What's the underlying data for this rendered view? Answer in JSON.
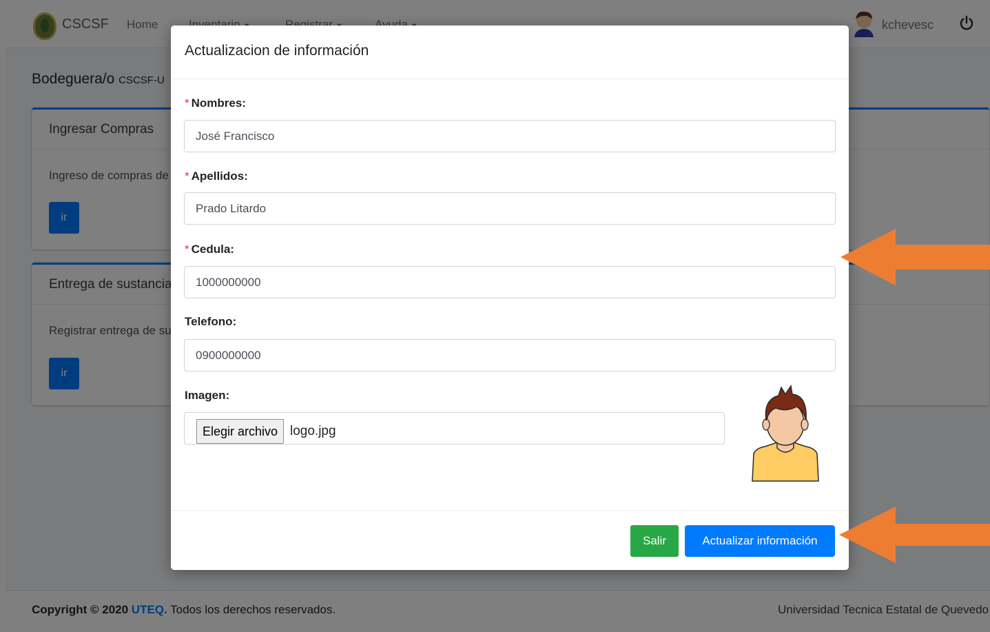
{
  "navbar": {
    "brand": "CSCSF",
    "links": [
      "Home",
      "Inventario",
      "Registrar",
      "Ayuda"
    ],
    "user": "kchevesc",
    "icons": {
      "logo": "university-logo",
      "avatar": "user-avatar-icon",
      "power": "power-icon",
      "dropdown": "caret-down-icon"
    }
  },
  "page": {
    "role_title": "Bodeguera/o",
    "role_code": "CSCSF-U",
    "cards": [
      {
        "title": "Ingresar Compras",
        "text": "Ingreso de compras de",
        "button": "ir"
      },
      {
        "title": "Entrega de sustancias",
        "text": "Registrar entrega de sustancias",
        "button": "ir"
      }
    ]
  },
  "footer": {
    "copyright_prefix": "Copyright © 2020",
    "brand": "UTEQ.",
    "rights": "Todos los derechos reservados.",
    "right_text": "Universidad Tecnica Estatal de Quevedo"
  },
  "modal": {
    "title": "Actualizacion de información",
    "required_mark": "*",
    "fields": {
      "nombres": {
        "label": "Nombres:",
        "value": "José Francisco",
        "required": true
      },
      "apellidos": {
        "label": "Apellidos:",
        "value": "Prado Litardo",
        "required": true
      },
      "cedula": {
        "label": "Cedula:",
        "value": "1000000000",
        "required": true
      },
      "telefono": {
        "label": "Telefono:",
        "value": "0900000000",
        "required": false
      }
    },
    "imagen": {
      "label": "Imagen:",
      "button": "Elegir archivo",
      "file_name": "logo.jpg"
    },
    "buttons": {
      "salir": "Salir",
      "actualizar": "Actualizar información"
    }
  },
  "colors": {
    "primary": "#007bff",
    "success": "#28a745",
    "danger": "#dc3545",
    "annotation_arrow": "#ed7d31"
  }
}
